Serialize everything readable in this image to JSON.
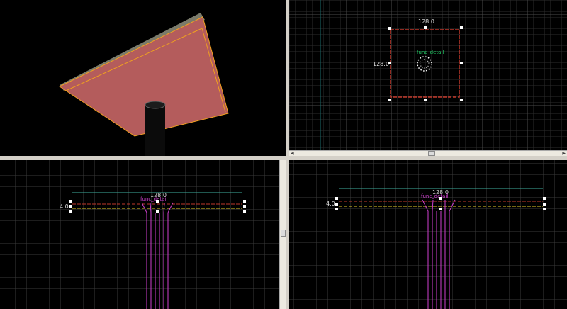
{
  "app": "Level editor",
  "viewports": {
    "camera": {
      "name": "3D camera view"
    },
    "top": {
      "dim_width": "128.0",
      "dim_height": "128.0",
      "entity_label": "func_detail"
    },
    "front": {
      "dim_width": "128.0",
      "dim_height": "4.0",
      "entity_label": "func_detail"
    },
    "side": {
      "dim_width": "128.0",
      "dim_height": "4.0",
      "entity_label": "func_detail"
    }
  },
  "colors": {
    "grid_minor": "#2c2c2c",
    "grid_major": "#5a5a5a",
    "selection_red": "#c0392b",
    "selection_yellow": "#e8d02a",
    "dimension_line": "#3fb0a0",
    "entity_magenta": "#d040d0",
    "entity_green": "#22cc66",
    "slab_face": "#b45c5c",
    "slab_edge": "#f0a020"
  }
}
